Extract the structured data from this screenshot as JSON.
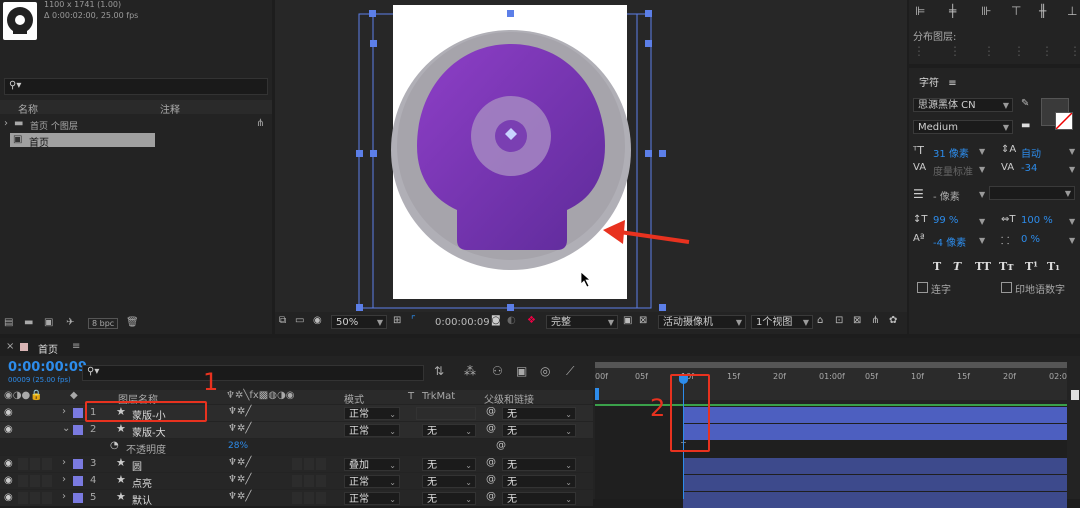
{
  "project": {
    "info_line1": "1100 x 1741 (1.00)",
    "info_line2": "Δ 0:00:02:00, 25.00 fps",
    "search_placeholder": "",
    "col_name": "名称",
    "col_comment": "注释",
    "folder_label": "首页 个图层",
    "comp_label": "首页",
    "bpc": "8 bpc"
  },
  "viewer": {
    "zoom": "50%",
    "timecode": "0:00:00:09",
    "quality": "完整",
    "camera": "活动摄像机",
    "views": "1个视图"
  },
  "align": {
    "distribute_label": "分布图层:"
  },
  "character": {
    "panel_title": "字符",
    "font_name": "思源黑体 CN",
    "font_style": "Medium",
    "size": "31 像素",
    "leading": "自动",
    "kerning": "度量标准",
    "tracking": "-34",
    "stroke_width": "- 像素",
    "vscale": "99 %",
    "hscale": "100 %",
    "baseline": "-4 像素",
    "tsume": "0 %",
    "styles": [
      "T",
      "T",
      "TT",
      "Tт",
      "T¹",
      "T₁"
    ],
    "ligatures": "连字",
    "hindi_digits": "印地语数字"
  },
  "timeline": {
    "tab": "首页",
    "current_time": "0:00:00:09",
    "frame_info": "00009 (25.00 fps)",
    "headers": {
      "layer_name": "图层名称",
      "mode": "模式",
      "t": "T",
      "trkmat": "TrkMat",
      "parent": "父级和链接"
    },
    "ruler": [
      "00f",
      "05f",
      "10f",
      "15f",
      "20f",
      "01:00f",
      "05f",
      "10f",
      "15f",
      "20f",
      "02:0"
    ],
    "layers": [
      {
        "num": "1",
        "name": "蒙版-小",
        "mode": "正常",
        "trkmat": "",
        "parent": "无"
      },
      {
        "num": "2",
        "name": "蒙版-大",
        "mode": "正常",
        "trkmat": "无",
        "parent": "无"
      },
      {
        "num": "3",
        "name": "圆",
        "mode": "叠加",
        "trkmat": "无",
        "parent": "无"
      },
      {
        "num": "4",
        "name": "点亮",
        "mode": "正常",
        "trkmat": "无",
        "parent": "无"
      },
      {
        "num": "5",
        "name": "默认",
        "mode": "正常",
        "trkmat": "无",
        "parent": "无"
      }
    ],
    "opacity_label": "不透明度",
    "opacity_value": "28%",
    "annotation_1": "1",
    "annotation_2": "2"
  },
  "colors": {
    "accent_blue": "#2d8ceb",
    "annotation_red": "#e8321f",
    "purple_gradient_start": "#8e3fc7",
    "purple_gradient_end": "#5e2b9a",
    "layer_bar_blue": "#4d5fc0"
  }
}
